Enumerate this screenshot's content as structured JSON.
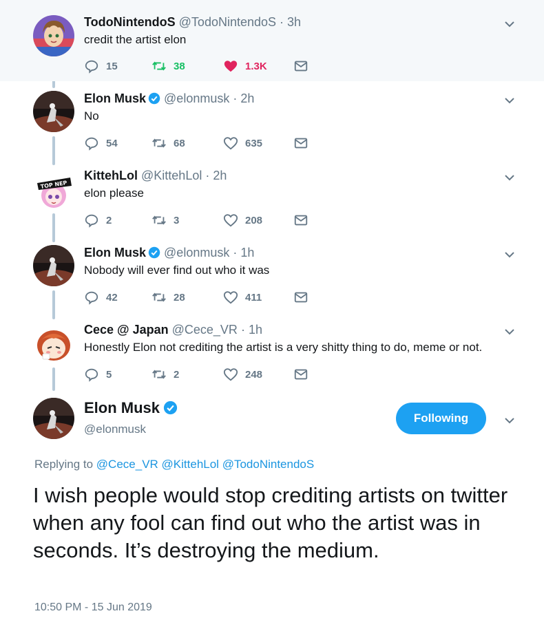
{
  "colors": {
    "accent": "#1da1f2",
    "link": "#1b95e0",
    "retweet_active": "#17bf63",
    "like_active": "#e0245e",
    "muted": "#657786",
    "thread_line": "#b6c9d8",
    "highlight_bg": "#f5f8fa"
  },
  "icons": {
    "reply": "reply-icon",
    "retweet": "retweet-icon",
    "like": "heart-icon",
    "dm": "envelope-icon",
    "more": "chevron-down-icon",
    "verified": "verified-badge-icon"
  },
  "replies": [
    {
      "name": "TodoNintendoS",
      "handle": "@TodoNintendoS",
      "time": "· 3h",
      "text": "credit the artist elon",
      "reply_count": "15",
      "retweet_count": "38",
      "like_count": "1.3K",
      "retweeted": true,
      "liked": true
    },
    {
      "name": "Elon Musk",
      "verified": true,
      "handle": "@elonmusk",
      "time": "· 2h",
      "text": "No",
      "reply_count": "54",
      "retweet_count": "68",
      "like_count": "635"
    },
    {
      "name": "KittehLol",
      "handle": "@KittehLol",
      "time": "· 2h",
      "text": "elon please",
      "reply_count": "2",
      "retweet_count": "3",
      "like_count": "208",
      "avatar_text": "TOP NEP"
    },
    {
      "name": "Elon Musk",
      "verified": true,
      "handle": "@elonmusk",
      "time": "· 1h",
      "text": "Nobody will ever find out who it was",
      "reply_count": "42",
      "retweet_count": "28",
      "like_count": "411"
    },
    {
      "name": "Cece @ Japan",
      "handle": "@Cece_VR",
      "time": "· 1h",
      "text": "Honestly Elon not crediting the artist is a very shitty thing to do, meme or not.",
      "reply_count": "5",
      "retweet_count": "2",
      "like_count": "248"
    }
  ],
  "main_tweet": {
    "name": "Elon Musk",
    "verified": true,
    "handle": "@elonmusk",
    "follow_label": "Following",
    "replying_prefix": "Replying to",
    "replying_to": [
      "@Cece_VR",
      "@KittehLol",
      "@TodoNintendoS"
    ],
    "text": "I wish people would stop crediting artists on twitter when any fool can find out who the artist was in seconds. It’s destroying the medium.",
    "timestamp": "10:50 PM - 15 Jun 2019"
  }
}
